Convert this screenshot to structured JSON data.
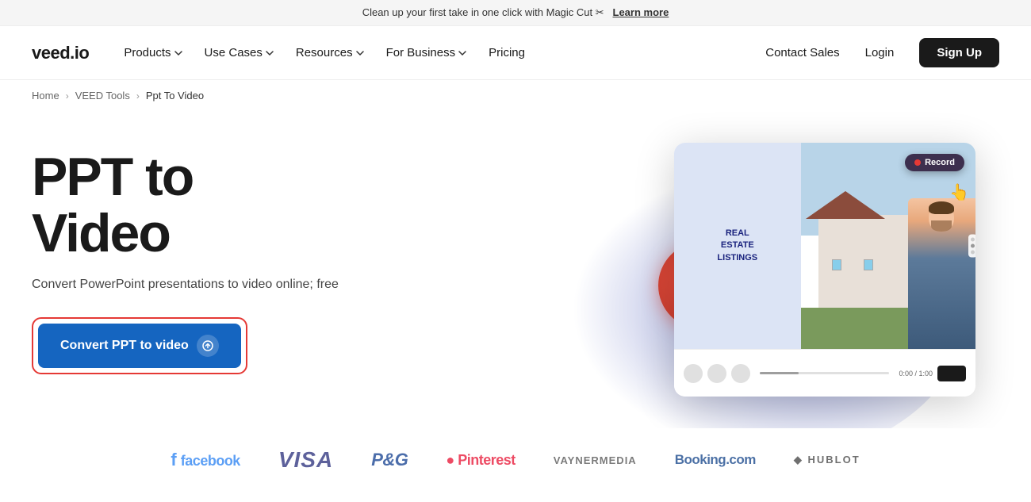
{
  "announcement": {
    "text": "Clean up your first take in one click with Magic Cut ✂",
    "link_text": "Learn more"
  },
  "nav": {
    "logo": "veed.io",
    "items": [
      {
        "label": "Products",
        "has_dropdown": true
      },
      {
        "label": "Use Cases",
        "has_dropdown": true
      },
      {
        "label": "Resources",
        "has_dropdown": true
      },
      {
        "label": "For Business",
        "has_dropdown": true
      },
      {
        "label": "Pricing",
        "has_dropdown": false
      }
    ],
    "contact_label": "Contact Sales",
    "login_label": "Login",
    "signup_label": "Sign Up"
  },
  "breadcrumb": {
    "home": "Home",
    "tools": "VEED Tools",
    "current": "Ppt To Video"
  },
  "hero": {
    "title_line1": "PPT to",
    "title_line2": "Video",
    "subtitle": "Convert PowerPoint presentations to video online; free",
    "cta_label": "Convert PPT to video"
  },
  "mockup": {
    "record_label": "Record",
    "slide_title_line1": "REAL",
    "slide_title_line2": "ESTATE",
    "slide_title_line3": "LISTINGS"
  },
  "brands": [
    {
      "id": "facebook",
      "label": "facebook",
      "class": "facebook"
    },
    {
      "id": "visa",
      "label": "VISA",
      "class": "visa"
    },
    {
      "id": "pg",
      "label": "P&G",
      "class": "pg"
    },
    {
      "id": "pinterest",
      "label": "Pinterest",
      "class": "pinterest"
    },
    {
      "id": "vaynermedia",
      "label": "VaynerMedia",
      "class": "vaynermedia"
    },
    {
      "id": "booking",
      "label": "Booking.com",
      "class": "booking"
    },
    {
      "id": "hublot",
      "label": "HUBLOT",
      "class": "hublot"
    }
  ]
}
